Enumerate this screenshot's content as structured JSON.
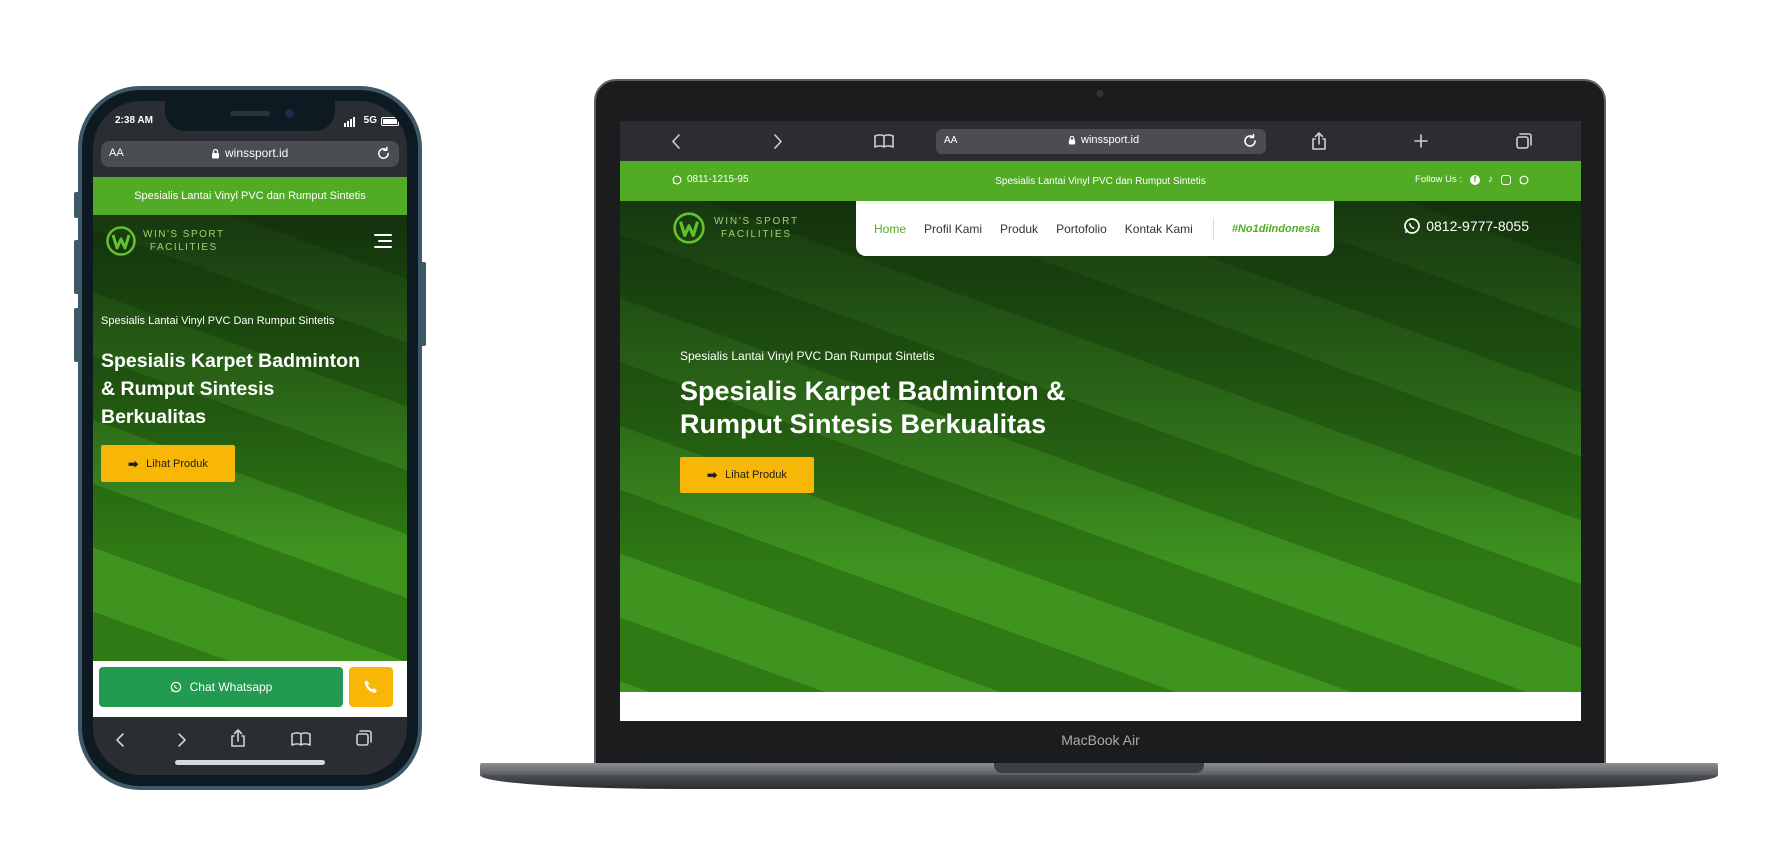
{
  "phone": {
    "status_time": "2:38 AM",
    "status_network": "5G",
    "url_aa": "AA",
    "url": "winssport.id",
    "topbar_text": "Spesialis Lantai Vinyl PVC dan Rumput Sintetis",
    "logo_line1": "WIN'S SPORT",
    "logo_line2": "FACILITIES",
    "hero_subtitle": "Spesialis Lantai Vinyl PVC Dan Rumput Sintetis",
    "hero_title": "Spesialis Karpet Badminton & Rumput Sintesis Berkualitas",
    "cta_label": "Lihat Produk",
    "chat_whatsapp_label": "Chat Whatsapp"
  },
  "laptop": {
    "url_aa": "AA",
    "url": "winssport.id",
    "topbar_phone": "0811-1215-95",
    "topbar_text": "Spesialis Lantai Vinyl PVC dan Rumput Sintetis",
    "follow_us": "Follow Us :",
    "logo_line1": "WIN'S SPORT",
    "logo_line2": "FACILITIES",
    "nav": {
      "home": "Home",
      "profil": "Profil Kami",
      "produk": "Produk",
      "portofolio": "Portofolio",
      "kontak": "Kontak Kami",
      "hashtag": "#No1diIndonesia"
    },
    "header_phone": "0812-9777-8055",
    "hero_subtitle": "Spesialis Lantai Vinyl PVC Dan Rumput Sintetis",
    "hero_title_line1": "Spesialis Karpet Badminton &",
    "hero_title_line2": "Rumput Sintesis Berkualitas",
    "cta_label": "Lihat Produk",
    "device_label": "MacBook Air"
  },
  "colors": {
    "brand_green": "#52ab25",
    "cta_yellow": "#f8b706",
    "whatsapp_green": "#229a4f",
    "nav_active": "#52ab25"
  }
}
